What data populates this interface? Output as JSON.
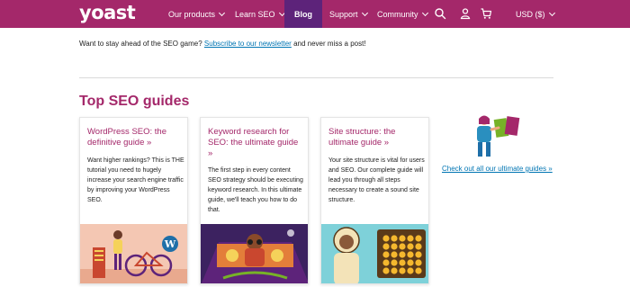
{
  "brand": {
    "logo_text": "yoast"
  },
  "nav": {
    "items": [
      {
        "label": "Our products",
        "has_dropdown": true
      },
      {
        "label": "Learn SEO",
        "has_dropdown": true
      },
      {
        "label": "Blog",
        "active": true
      },
      {
        "label": "Support",
        "has_dropdown": true
      },
      {
        "label": "Community",
        "has_dropdown": true
      }
    ],
    "currency": "USD ($)"
  },
  "intro": {
    "text_before": "Want to stay ahead of the SEO game?",
    "link": "Subscribe to our newsletter",
    "text_after": "and never miss a post!"
  },
  "section": {
    "title": "Top SEO guides"
  },
  "cards": [
    {
      "title": "WordPress SEO: the definitive guide »",
      "text": "Want higher rankings? This is THE tutorial you need to hugely increase your search engine traffic by improving your WordPress SEO."
    },
    {
      "title": "Keyword research for SEO: the ultimate guide »",
      "text": "The first step in every content SEO strategy should be executing keyword research. In this ultimate guide, we'll teach you how to do that."
    },
    {
      "title": "Site structure: the ultimate guide »",
      "text": "Your site structure is vital for users and SEO. Our complete guide will lead you through all steps necessary to create a sound site structure."
    }
  ],
  "all_guides_link": "Check out all our ultimate guides »",
  "colors": {
    "brand": "#a4286a",
    "nav_active": "#5d237a",
    "link": "#0075b3",
    "accent_green": "#77b227"
  },
  "icons": [
    "search-icon",
    "user-icon",
    "cart-icon",
    "chevron-down-icon"
  ]
}
